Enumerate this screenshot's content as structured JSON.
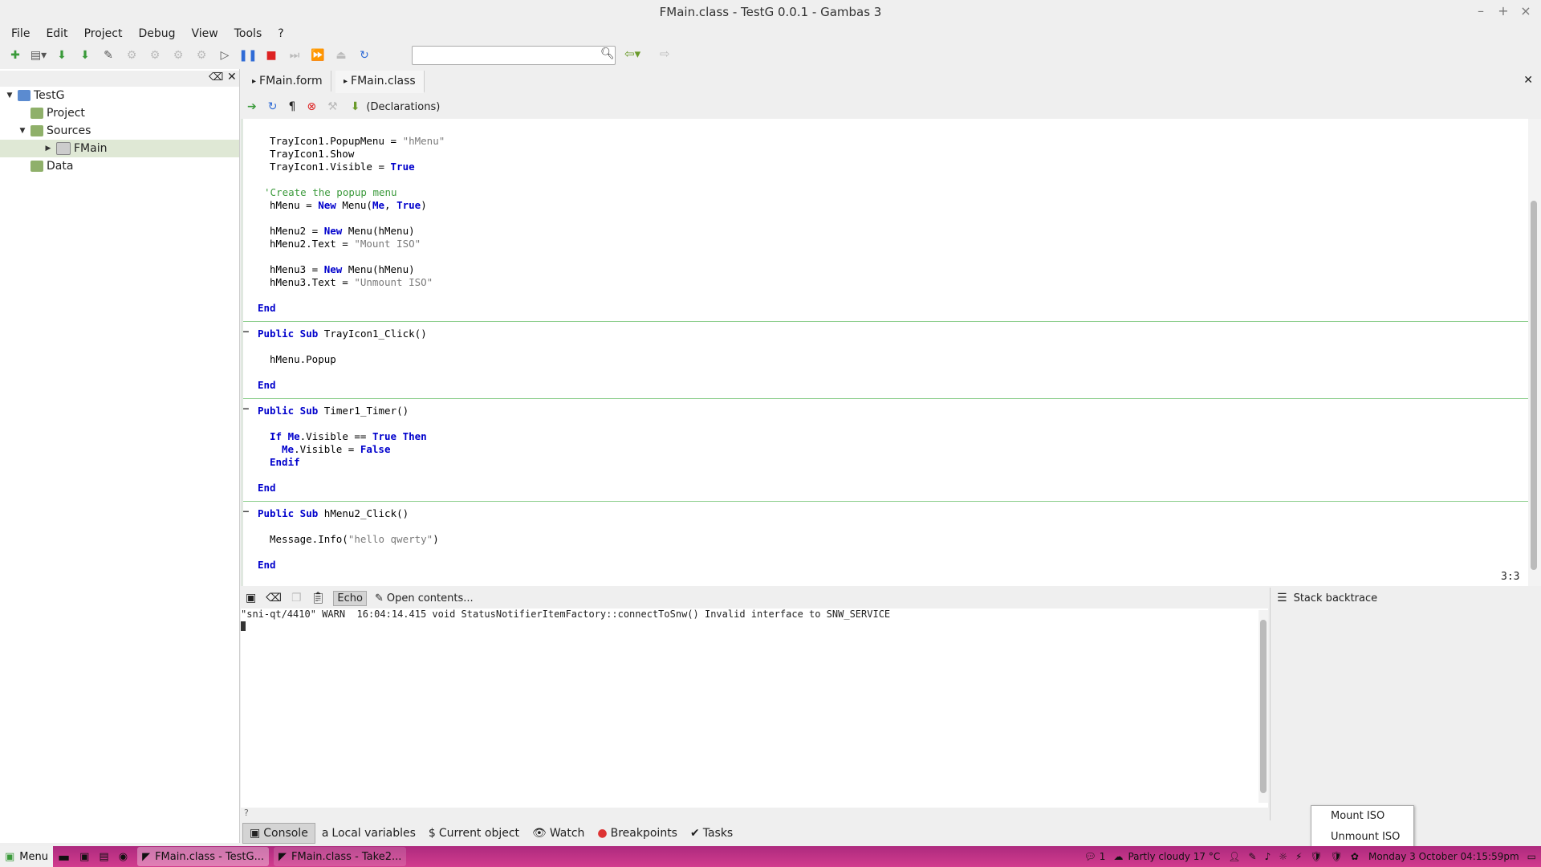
{
  "window": {
    "title": "FMain.class - TestG 0.0.1 - Gambas 3",
    "controls": [
      "–",
      "+",
      "×"
    ]
  },
  "menu": [
    "File",
    "Edit",
    "Project",
    "Debug",
    "View",
    "Tools",
    "?"
  ],
  "tree": {
    "root": "TestG",
    "items": [
      {
        "label": "Project"
      },
      {
        "label": "Sources"
      },
      {
        "label": "FMain"
      },
      {
        "label": "Data"
      }
    ]
  },
  "tabs": [
    {
      "label": "FMain.form"
    },
    {
      "label": "FMain.class"
    }
  ],
  "editor_toolbar": {
    "procedure": "(Declarations)"
  },
  "code": {
    "lines": [
      [
        "TrayIcon1.PopupMenu = ",
        "\"hMenu\""
      ],
      [
        "TrayIcon1.Show"
      ],
      [
        "TrayIcon1.Visible = ",
        "True"
      ],
      [
        "'Create the popup menu"
      ],
      [
        "hMenu = ",
        "New",
        " Menu(",
        "Me",
        ", ",
        "True",
        ")"
      ],
      [
        "hMenu2 = ",
        "New",
        " Menu(hMenu)"
      ],
      [
        "hMenu2.Text = ",
        "\"Mount ISO\""
      ],
      [
        "hMenu3 = ",
        "New",
        " Menu(hMenu)"
      ],
      [
        "hMenu3.Text = ",
        "\"Unmount ISO\""
      ],
      [
        "End"
      ],
      [
        "Public Sub",
        " TrayIcon1_Click()"
      ],
      [
        "hMenu.Popup"
      ],
      [
        "End"
      ],
      [
        "Public Sub",
        " Timer1_Timer()"
      ],
      [
        "If Me",
        ".Visible == ",
        "True Then"
      ],
      [
        "Me",
        ".Visible = ",
        "False"
      ],
      [
        "Endif"
      ],
      [
        "End"
      ],
      [
        "Public Sub",
        " hMenu2_Click()"
      ],
      [
        "Message.Info(",
        "\"hello qwerty\"",
        ")"
      ],
      [
        "End"
      ]
    ],
    "cursor": "3:3"
  },
  "console": {
    "toolbar": {
      "echo": "Echo",
      "open": "Open contents..."
    },
    "output": "\"sni-qt/4410\" WARN  16:04:14.415 void StatusNotifierItemFactory::connectToSnw() Invalid interface to SNW_SERVICE",
    "prompt": "?"
  },
  "stack_panel": {
    "title": "Stack backtrace"
  },
  "bottom_tabs": [
    "Console",
    "Local variables",
    "Current object",
    "Watch",
    "Breakpoints",
    "Tasks"
  ],
  "popup_menu": [
    "Mount ISO",
    "Unmount ISO"
  ],
  "taskbar": {
    "menu": "Menu",
    "windows": [
      "FMain.class - TestG...",
      "FMain.class - Take2..."
    ],
    "notifications": "1",
    "weather": "Partly cloudy 17 °C",
    "clock": "Monday  3 October 04:15:59pm"
  }
}
